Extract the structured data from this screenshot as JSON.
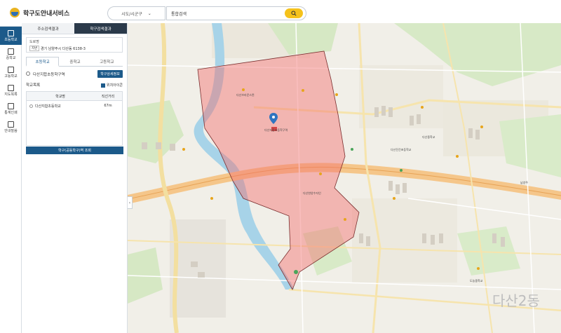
{
  "app": {
    "title": "학구도안내서비스"
  },
  "header": {
    "region_select": "시도/시군구",
    "search_value": "통합검색"
  },
  "leftnav": [
    {
      "label": "초등학교",
      "active": true
    },
    {
      "label": "중학교"
    },
    {
      "label": "고등학교"
    },
    {
      "label": "지도목록"
    },
    {
      "label": "통계인쇄"
    },
    {
      "label": "안내말씀"
    }
  ],
  "panel": {
    "tabs": [
      "주소검색결과",
      "학구검색결과"
    ],
    "address_label": "도로명",
    "address_badge": "지번",
    "address_value": "경기 남양주시 다산동 6138-3",
    "level_tabs": [
      "초등학교",
      "중학교",
      "고등학교"
    ],
    "district_name": "다산지합초등학구역",
    "detail_button": "학구상세정보",
    "list_title": "학교목록",
    "checkbox_label": "위치아이콘",
    "table_headers": [
      "학교명",
      "직선거리"
    ],
    "schools": [
      {
        "name": "다산지합초등학교",
        "distance": "67m"
      }
    ],
    "lookup_button": "학구(공동학구)역 조회"
  },
  "map": {
    "labels": [
      {
        "text": "다산브라운스톤",
        "cls": "a"
      },
      {
        "text": "다산진건초등학교",
        "cls": "b"
      },
      {
        "text": "다산지합초등학구역",
        "cls": "c"
      },
      {
        "text": "다산한양수자인",
        "cls": "d"
      },
      {
        "text": "다산중학교",
        "cls": "e"
      },
      {
        "text": "도농중학교",
        "cls": "f"
      },
      {
        "text": "다산2동",
        "cls": "g"
      },
      {
        "text": "남양주",
        "cls": "h"
      }
    ],
    "district_label": "다산2동"
  }
}
